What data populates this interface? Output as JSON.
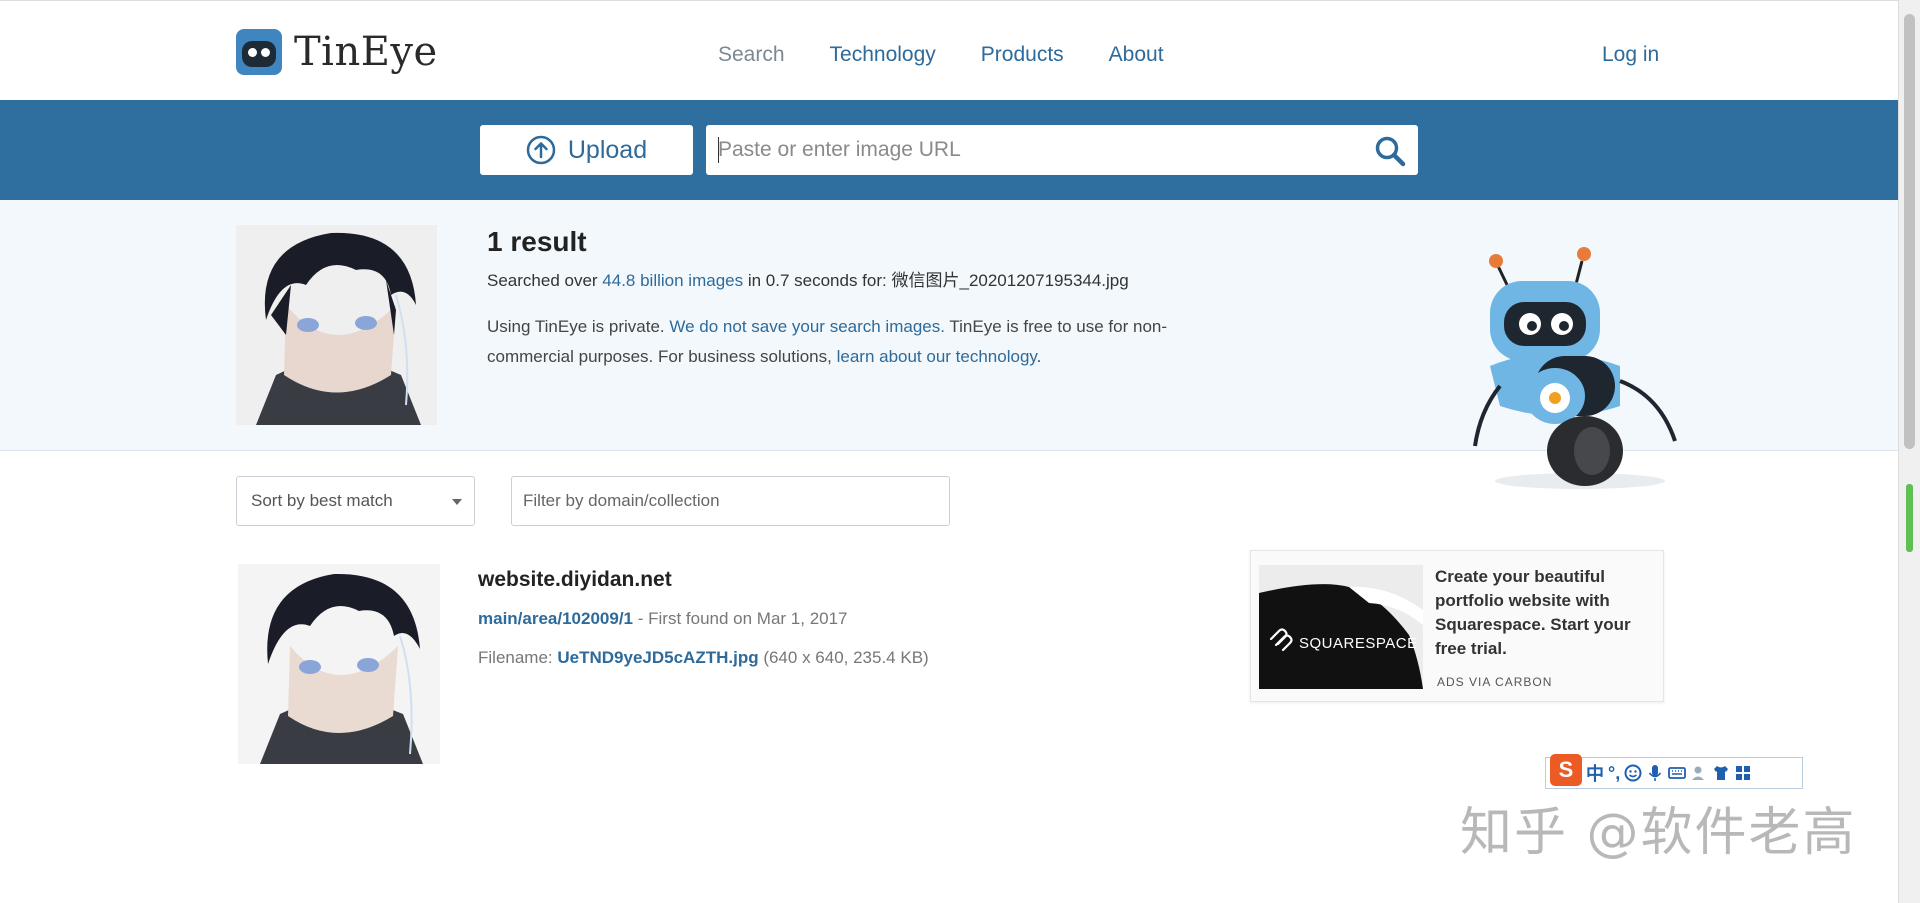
{
  "header": {
    "logo_text": "TinEye",
    "nav": [
      {
        "label": "Search",
        "current": true
      },
      {
        "label": "Technology"
      },
      {
        "label": "Products"
      },
      {
        "label": "About"
      }
    ],
    "login_label": "Log in"
  },
  "searchbar": {
    "upload_label": "Upload",
    "url_placeholder": "Paste or enter image URL",
    "url_value": ""
  },
  "summary": {
    "result_count": "1 result",
    "searched_prefix": "Searched over ",
    "searched_link": "44.8 billion images",
    "searched_mid": " in 0.7 seconds for: ",
    "query_filename": "微信图片_20201207195344.jpg",
    "private_1": "Using TinEye is private. ",
    "private_link": "We do not save your search images.",
    "private_2": " TinEye is free to use for non-commercial purposes. For business solutions, ",
    "business_link": "learn about our technology",
    "private_end": "."
  },
  "filters": {
    "sort_label": "Sort by best match",
    "filter_placeholder": "Filter by domain/collection"
  },
  "results": [
    {
      "domain": "website.diyidan.net",
      "path": "main/area/102009/1",
      "first_found": " - First found on Mar 1, 2017",
      "filename_label": "Filename: ",
      "filename": "UeTND9yeJD5cAZTH.jpg",
      "file_meta": " (640 x 640, 235.4 KB)"
    }
  ],
  "ad": {
    "brand": "SQUARESPACE",
    "text": "Create your beautiful portfolio website with Squarespace. Start your free trial.",
    "via": "ADS VIA CARBON"
  },
  "ime": {
    "logo": "S",
    "mode": "中",
    "punct": "°,"
  },
  "watermark": "知乎 @软件老高",
  "colors": {
    "link": "#2e6a9a",
    "searchbar_bg": "#2f6f9f",
    "summary_bg": "#f3f8fc"
  }
}
